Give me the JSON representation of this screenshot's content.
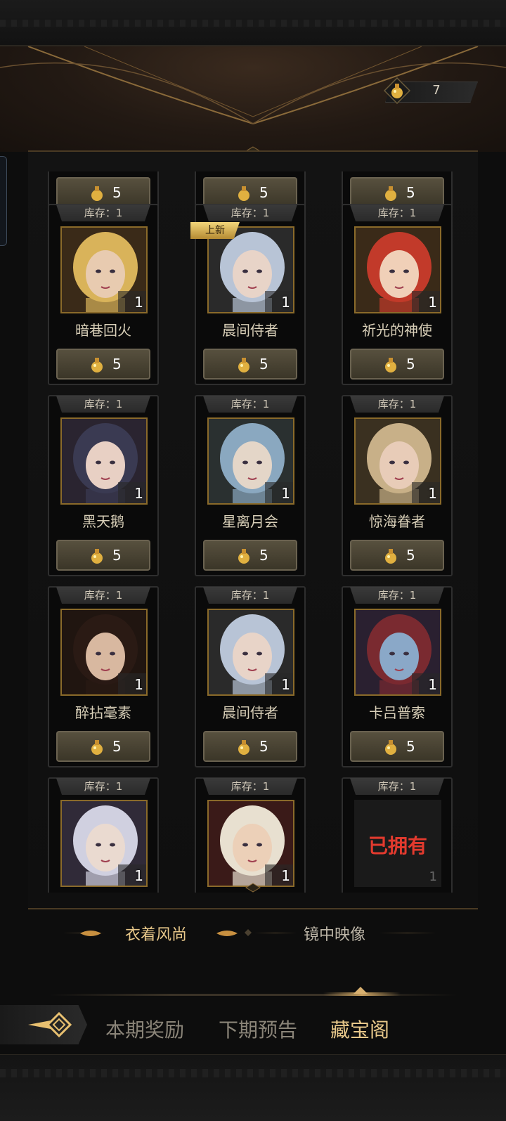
{
  "header": {
    "currency": {
      "icon": "gold-coin-flask-icon",
      "value": "7"
    }
  },
  "gallery": {
    "partial_row_price": "5",
    "cards": [
      {
        "stock": "库存：1",
        "name": "暗巷回火",
        "qty": "1",
        "price": "5",
        "new_badge": "",
        "owned": false,
        "hair": "#d9b35a",
        "skin": "#e8cbb0",
        "bg": "#3a2a18"
      },
      {
        "stock": "库存：1",
        "name": "晨间侍者",
        "qty": "1",
        "price": "5",
        "new_badge": "上新",
        "owned": false,
        "hair": "#b8c4d6",
        "skin": "#e8d4c8",
        "bg": "#2a2a2a"
      },
      {
        "stock": "库存：1",
        "name": "祈光的神使",
        "qty": "1",
        "price": "5",
        "new_badge": "",
        "owned": false,
        "hair": "#c23a2a",
        "skin": "#f0d0b8",
        "bg": "#3a2a18"
      },
      {
        "stock": "库存：1",
        "name": "黑天鹅",
        "qty": "1",
        "price": "5",
        "new_badge": "",
        "owned": false,
        "hair": "#3a3a52",
        "skin": "#e8d0c4",
        "bg": "#2a2430"
      },
      {
        "stock": "库存：1",
        "name": "星离月会",
        "qty": "1",
        "price": "5",
        "new_badge": "",
        "owned": false,
        "hair": "#8aa8c0",
        "skin": "#e4d6c8",
        "bg": "#2a3030"
      },
      {
        "stock": "库存：1",
        "name": "惊海眷者",
        "qty": "1",
        "price": "5",
        "new_badge": "",
        "owned": false,
        "hair": "#c8b088",
        "skin": "#e8ccb8",
        "bg": "#3a3020"
      },
      {
        "stock": "库存：1",
        "name": "醉拈毫素",
        "qty": "1",
        "price": "5",
        "new_badge": "",
        "owned": false,
        "hair": "#2a1a14",
        "skin": "#d8b8a0",
        "bg": "#201510"
      },
      {
        "stock": "库存：1",
        "name": "晨间侍者",
        "qty": "1",
        "price": "5",
        "new_badge": "",
        "owned": false,
        "hair": "#b8c4d6",
        "skin": "#e8d4c8",
        "bg": "#2a2a2a"
      },
      {
        "stock": "库存：1",
        "name": "卡吕普索",
        "qty": "1",
        "price": "5",
        "new_badge": "",
        "owned": false,
        "hair": "#7a2a30",
        "skin": "#8aa8c8",
        "bg": "#2a2030"
      },
      {
        "stock": "库存：1",
        "name": "",
        "qty": "1",
        "price": "",
        "new_badge": "",
        "owned": false,
        "hair": "#d0d0e0",
        "skin": "#eadad0",
        "bg": "#302a38"
      },
      {
        "stock": "库存：1",
        "name": "",
        "qty": "1",
        "price": "",
        "new_badge": "",
        "owned": false,
        "hair": "#e8e0d0",
        "skin": "#ecd0b8",
        "bg": "#3a1a18"
      },
      {
        "stock": "库存：1",
        "name": "",
        "qty": "1",
        "price": "",
        "new_badge": "",
        "owned": true,
        "owned_text": "已拥有",
        "hair": "#2a2a2a",
        "skin": "#2a2a2a",
        "bg": "#1a1a1a"
      }
    ]
  },
  "subtabs": {
    "items": [
      {
        "label": "衣着风尚",
        "active": true
      },
      {
        "label": "镜中映像",
        "active": false
      }
    ]
  },
  "bottom_nav": {
    "back_icon": "diamond-arrow-back-icon",
    "tabs": [
      {
        "label": "本期奖励",
        "active": false
      },
      {
        "label": "下期预告",
        "active": false
      },
      {
        "label": "藏宝阁",
        "active": true
      }
    ]
  },
  "colors": {
    "accent_gold": "#e8c88a",
    "owned_red": "#e23a2e",
    "card_border": "#2e2e2e",
    "portrait_border": "#8a6a2a"
  }
}
